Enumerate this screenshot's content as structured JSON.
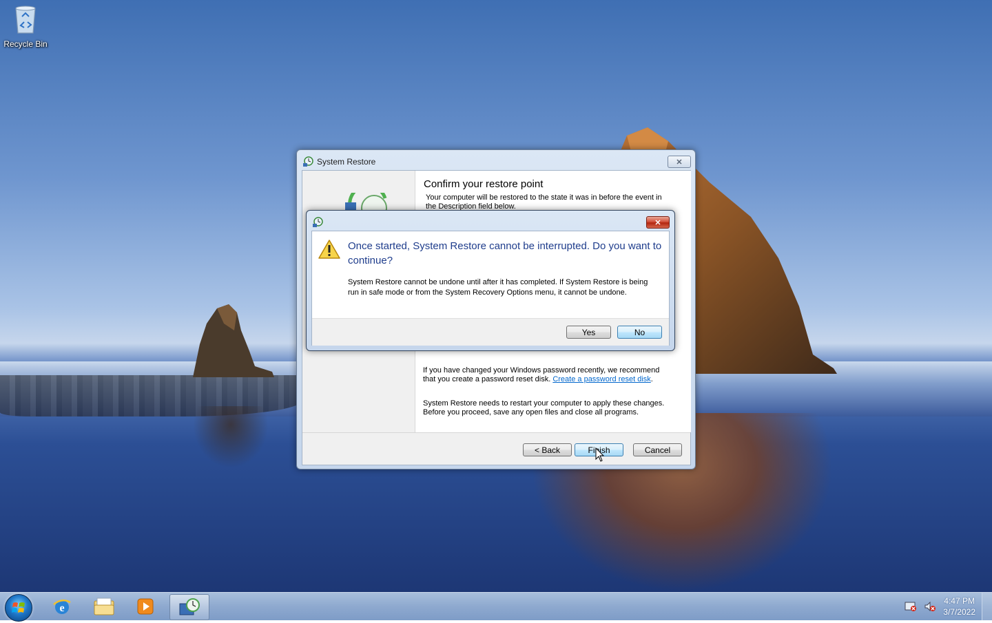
{
  "desktop": {
    "icons": [
      {
        "label": "Recycle Bin",
        "icon": "recycle-bin-icon"
      }
    ]
  },
  "wizard": {
    "title": "System Restore",
    "heading": "Confirm your restore point",
    "description": "Your computer will be restored to the state it was in before the event in the Description field below.",
    "password_text": "If you have changed your Windows password recently, we recommend that you create a password reset disk.",
    "password_link": "Create a password reset disk",
    "restart_text": "System Restore needs to restart your computer to apply these changes. Before you proceed, save any open files and close all programs.",
    "buttons": {
      "back": "< Back",
      "finish": "Finish",
      "cancel": "Cancel"
    }
  },
  "confirm_dialog": {
    "main_instruction": "Once started, System Restore cannot be interrupted. Do you want to continue?",
    "content": "System Restore cannot be undone until after it has completed. If System Restore is being run in safe mode or from the System Recovery Options menu, it cannot be undone.",
    "buttons": {
      "yes": "Yes",
      "no": "No"
    },
    "icon": "warning-icon"
  },
  "taskbar": {
    "items": [
      "start-button",
      "internet-explorer",
      "windows-explorer",
      "windows-media-player",
      "system-restore"
    ],
    "clock": {
      "time": "4:47 PM",
      "date": "3/7/2022"
    },
    "tray_icons": [
      "action-center-icon",
      "volume-muted-icon"
    ]
  },
  "colors": {
    "instruction_blue": "#1f3d8c",
    "link": "#0066cc",
    "close_red": "#c13a23"
  }
}
